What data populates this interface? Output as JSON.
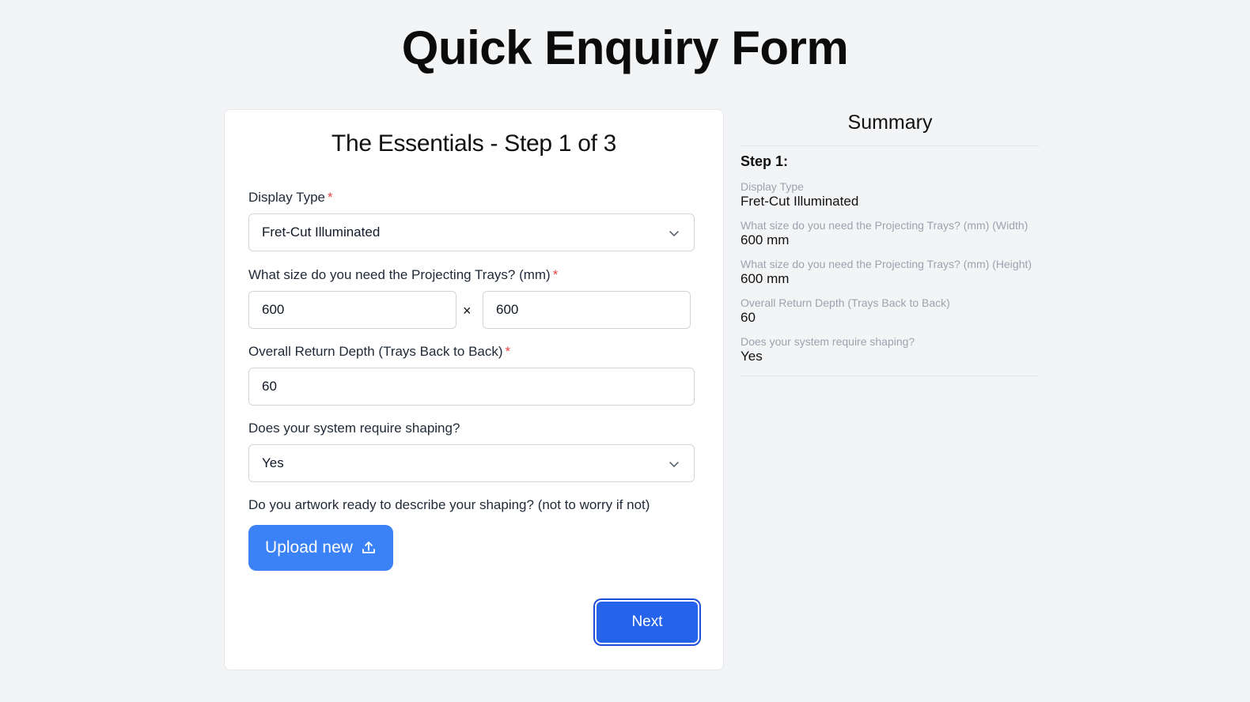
{
  "page": {
    "title": "Quick Enquiry Form"
  },
  "form": {
    "step_title": "The Essentials - Step 1 of 3",
    "required_mark": "*",
    "display_type": {
      "label": "Display Type",
      "value": "Fret-Cut Illuminated"
    },
    "tray_size": {
      "label": "What size do you need the Projecting Trays? (mm)",
      "width_value": "600",
      "separator": "×",
      "height_value": "600"
    },
    "return_depth": {
      "label": "Overall Return Depth (Trays Back to Back)",
      "value": "60"
    },
    "shaping": {
      "label": "Does your system require shaping?",
      "value": "Yes"
    },
    "artwork": {
      "label": "Do you artwork ready to describe your shaping? (not to worry if not)",
      "upload_label": "Upload new"
    },
    "next_label": "Next"
  },
  "summary": {
    "title": "Summary",
    "step_heading": "Step 1:",
    "items": [
      {
        "label": "Display Type",
        "value": "Fret-Cut Illuminated"
      },
      {
        "label": "What size do you need the Projecting Trays? (mm) (Width)",
        "value": "600 mm"
      },
      {
        "label": "What size do you need the Projecting Trays? (mm) (Height)",
        "value": "600 mm"
      },
      {
        "label": "Overall Return Depth (Trays Back to Back)",
        "value": "60"
      },
      {
        "label": "Does your system require shaping?",
        "value": "Yes"
      }
    ]
  },
  "colors": {
    "background": "#f3f4f6",
    "upload_button": "#3b82f6",
    "next_button": "#2563eb",
    "required": "#ef4444"
  },
  "icons": {
    "select_chevron": "chevron-down-icon",
    "upload": "upload-icon"
  }
}
